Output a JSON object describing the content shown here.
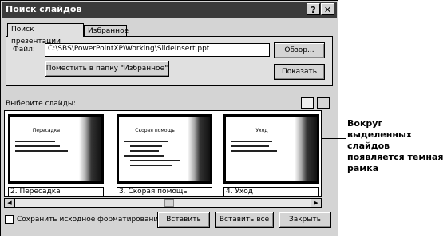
{
  "window": {
    "title": "Поиск слайдов"
  },
  "tabs": [
    {
      "label": "Поиск презентации"
    },
    {
      "label": "Избранное"
    }
  ],
  "file": {
    "label": "Файл:",
    "value": "C:\\SBS\\PowerPointXP\\Working\\SlideInsert.ppt",
    "browse_label": "Обзор...",
    "add_favorites_label": "Поместить в папку \"Избранное\"",
    "show_label": "Показать"
  },
  "slides": {
    "label": "Выберите слайды:",
    "items": [
      {
        "caption": "2. Пересадка",
        "title": "Пересадка"
      },
      {
        "caption": "3. Скорая помощь",
        "title": "Скорая помощь"
      },
      {
        "caption": "4. Уход",
        "title": "Уход"
      }
    ]
  },
  "footer": {
    "keep_format_label": "Сохранить исходное форматирование",
    "insert_label": "Вставить",
    "insert_all_label": "Вставить все",
    "close_label": "Закрыть"
  },
  "callout": {
    "text": "Вокруг выделенных слайдов появляется темная рамка"
  },
  "icons": [
    "help-icon",
    "close-icon",
    "view-thumbnails-icon",
    "view-list-icon",
    "scroll-left-icon",
    "scroll-right-icon"
  ]
}
